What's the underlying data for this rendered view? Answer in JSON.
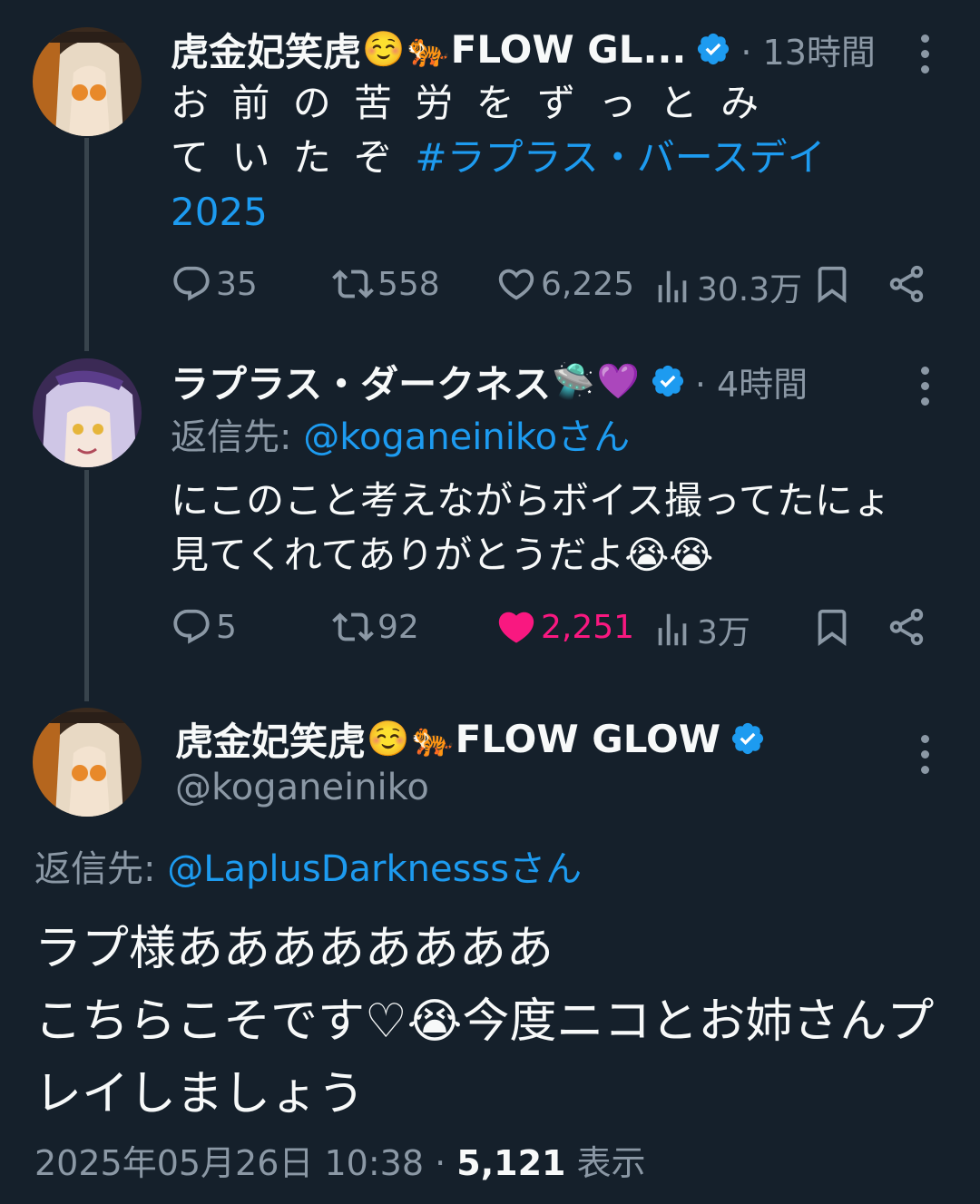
{
  "tweet1": {
    "display_name": "虎金妃笑虎",
    "emoji_1": "☺️",
    "emoji_2": "🐅",
    "name_suffix": "FLOW GL...",
    "time": "· 13時間",
    "text_line1": "お 前 の 苦 労 を ず っ と み",
    "text_line2": "て い た ぞ",
    "hashtag": "#ラプラス・バースデイ",
    "hashtag_line2": "2025",
    "replies": "35",
    "retweets": "558",
    "likes": "6,225",
    "views": "30.3万"
  },
  "tweet2": {
    "display_name": "ラプラス・ダークネス",
    "emoji_1": "🛸",
    "emoji_2": "💜",
    "time": "· 4時間",
    "reply_prefix": "返信先: ",
    "reply_to": "@koganeinikoさん",
    "text_line1": "にこのこと考えながらボイス撮ってたにょ",
    "text_line2": "見てくれてありがとうだよ😭😭",
    "replies": "5",
    "retweets": "92",
    "likes": "2,251",
    "views": "3万"
  },
  "tweet3": {
    "display_name": "虎金妃笑虎",
    "emoji_1": "☺️",
    "emoji_2": "🐅",
    "name_suffix": "FLOW GLOW",
    "handle": "@koganeiniko",
    "reply_prefix": "返信先: ",
    "reply_to": "@LaplusDarknesssさん",
    "text_line1": "ラプ様ああああああああ",
    "text_line2": "こちらこそです♡😭今度ニコとお姉さんプ",
    "text_line3": "レイしましょう",
    "timestamp": "2025年05月26日 10:38 · ",
    "views_count": "5,121",
    "views_label": " 表示"
  },
  "colors": {
    "background": "#15202b",
    "text": "#f7f9f9",
    "secondary": "#8b98a5",
    "link": "#1d9bf0",
    "like": "#f91880",
    "verified": "#1d9bf0"
  }
}
